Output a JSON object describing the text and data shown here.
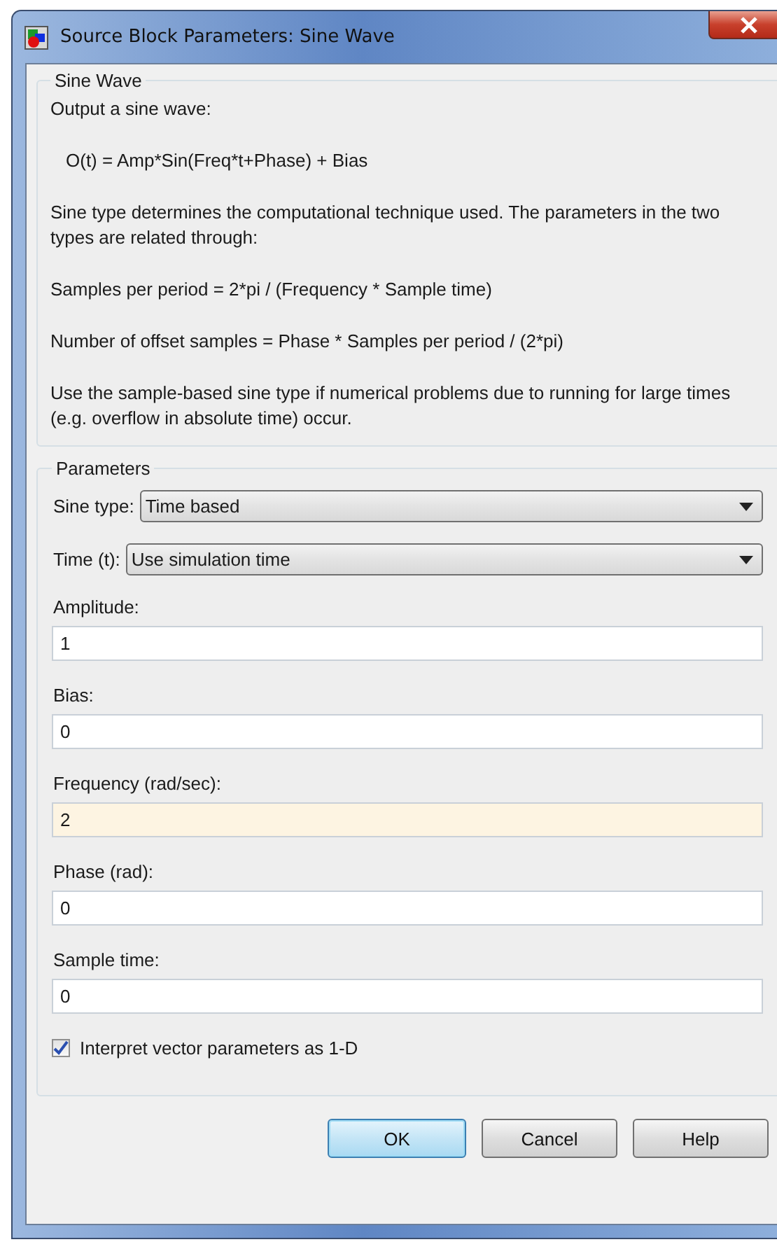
{
  "window": {
    "title": "Source Block Parameters: Sine Wave"
  },
  "description": {
    "title": "Sine Wave",
    "paragraphs": [
      {
        "kind": "text",
        "text": "Output a sine wave:"
      },
      {
        "kind": "formula",
        "text": "O(t) = Amp*Sin(Freq*t+Phase) + Bias"
      },
      {
        "kind": "text",
        "text": "Sine type determines the computational technique used. The parameters in the two types are related through:"
      },
      {
        "kind": "text",
        "text": "Samples per period = 2*pi / (Frequency * Sample time)"
      },
      {
        "kind": "text",
        "text": "Number of offset samples = Phase * Samples per period / (2*pi)"
      },
      {
        "kind": "text",
        "text": "Use the sample-based sine type if numerical problems due to running for large times (e.g. overflow in absolute time) occur."
      }
    ]
  },
  "parameters": {
    "title": "Parameters",
    "dropdowns": [
      {
        "label": "Sine type:",
        "value": "Time based"
      },
      {
        "label": "Time (t):",
        "value": "Use simulation time"
      }
    ],
    "fields": [
      {
        "label": "Amplitude:",
        "value": "1",
        "highlighted": false
      },
      {
        "label": "Bias:",
        "value": "0",
        "highlighted": false
      },
      {
        "label": "Frequency (rad/sec):",
        "value": "2",
        "highlighted": true
      },
      {
        "label": "Phase (rad):",
        "value": "0",
        "highlighted": false
      },
      {
        "label": "Sample time:",
        "value": "0",
        "highlighted": false
      }
    ],
    "checkbox": {
      "label": "Interpret vector parameters as 1-D",
      "checked": true
    }
  },
  "buttons": [
    {
      "label": "OK",
      "default": true
    },
    {
      "label": "Cancel",
      "default": false
    },
    {
      "label": "Help",
      "default": false
    }
  ]
}
